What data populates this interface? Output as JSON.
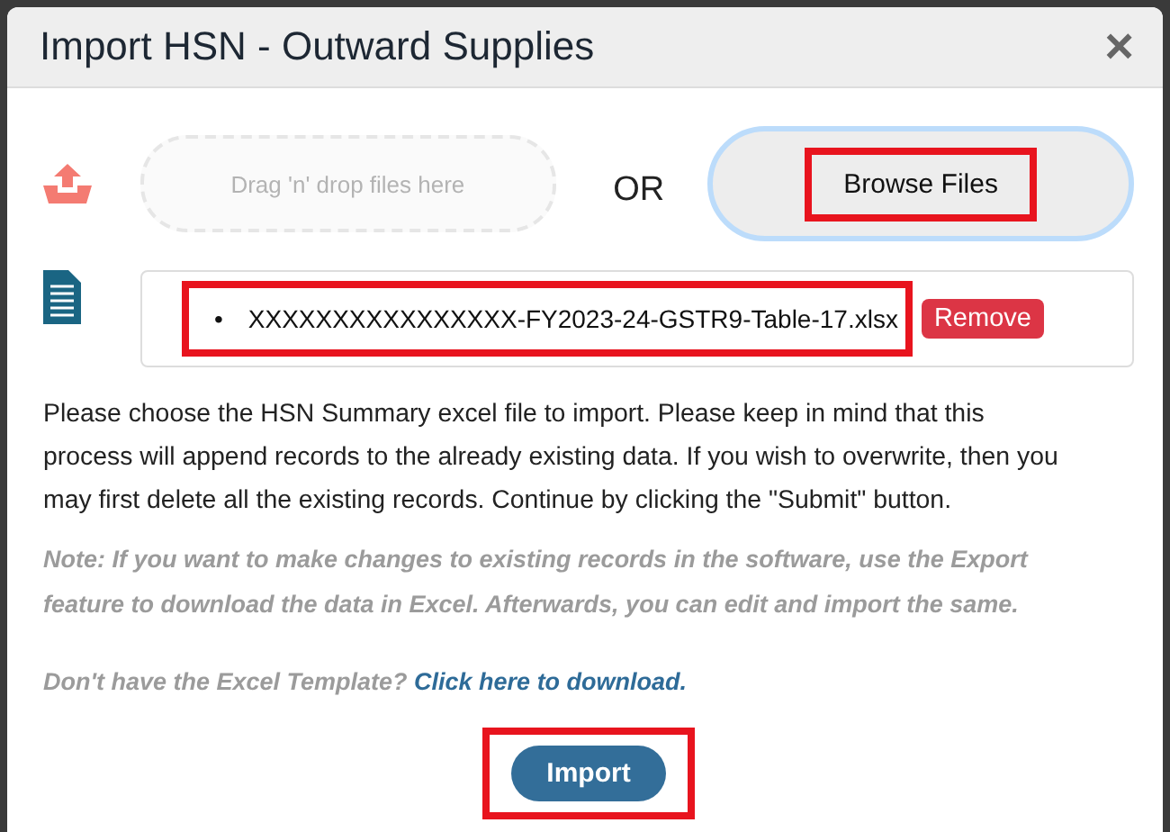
{
  "dialog": {
    "title": "Import HSN - Outward Supplies",
    "close": "×"
  },
  "upload": {
    "dropzone_placeholder": "Drag 'n' drop files here",
    "or": "OR",
    "browse": {
      "label": "Browse Files",
      "highlighted": true
    }
  },
  "files": [
    {
      "bullet": "•",
      "name": "XXXXXXXXXXXXXXXX-FY2023-24-GSTR9-Table-17.xlsx",
      "remove": "Remove",
      "highlighted": true
    }
  ],
  "instructions": "Please choose the HSN Summary excel file to import. Please keep in mind that this process will append records to the already existing data. If you wish to overwrite, then you may first delete all the existing records. Continue by clicking the \"Submit\" button.",
  "note": "Note: If you want to make changes to existing records in the software, use the Export feature to download the data in Excel. Afterwards, you can edit and import the same.",
  "template": {
    "question": "Don't have the Excel Template?",
    "link": "Click here to download."
  },
  "import_button": {
    "label": "Import",
    "highlighted": true
  }
}
